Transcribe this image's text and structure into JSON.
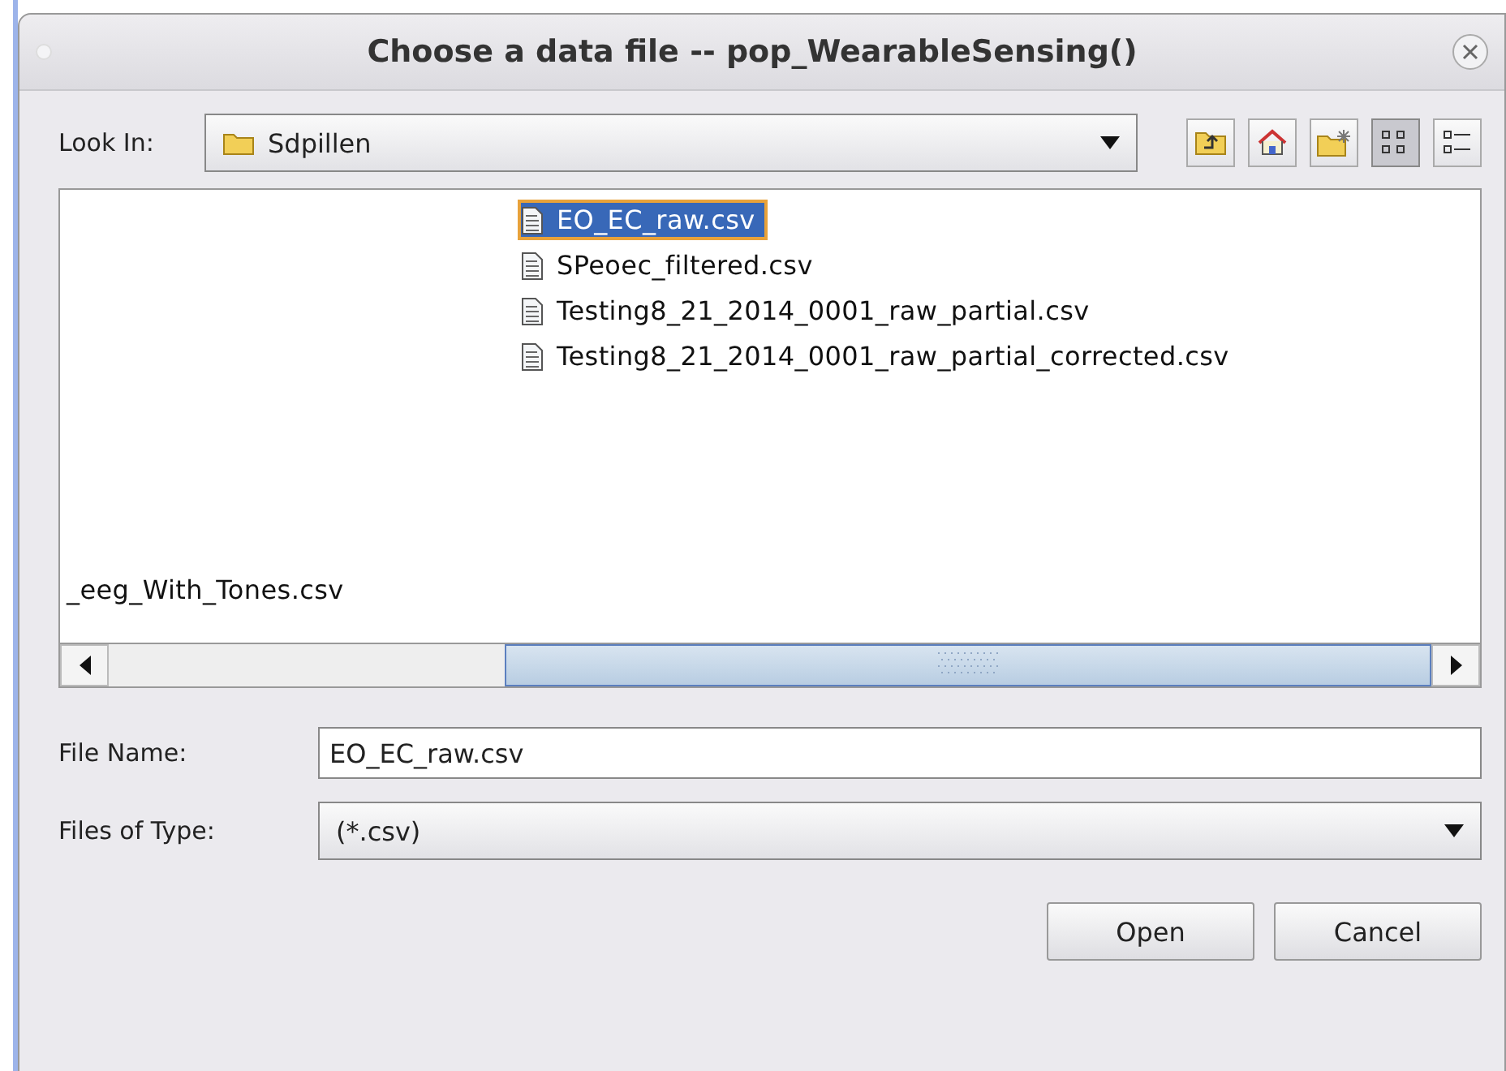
{
  "window": {
    "title": "Choose a data file -- pop_WearableSensing()"
  },
  "look_in": {
    "label": "Look In:",
    "value": "Sdpillen"
  },
  "toolbar": [
    {
      "kind": "up"
    },
    {
      "kind": "home"
    },
    {
      "kind": "new-folder"
    },
    {
      "kind": "list",
      "selected": true
    },
    {
      "kind": "details",
      "selected": false
    }
  ],
  "file_columns": [
    [
      {
        "name": "_eeg_With_Tones.csv",
        "selected": false
      }
    ],
    [
      {
        "name": "EO_EC_raw.csv",
        "selected": true
      },
      {
        "name": "SPeoec_filtered.csv",
        "selected": false
      },
      {
        "name": "Testing8_21_2014_0001_raw_partial.csv",
        "selected": false
      },
      {
        "name": "Testing8_21_2014_0001_raw_partial_corrected.csv",
        "selected": false
      }
    ]
  ],
  "file_name": {
    "label": "File Name:",
    "value": "EO_EC_raw.csv"
  },
  "file_type": {
    "label": "Files of Type:",
    "value": "(*.csv)"
  },
  "buttons": [
    "Open",
    "Cancel"
  ]
}
